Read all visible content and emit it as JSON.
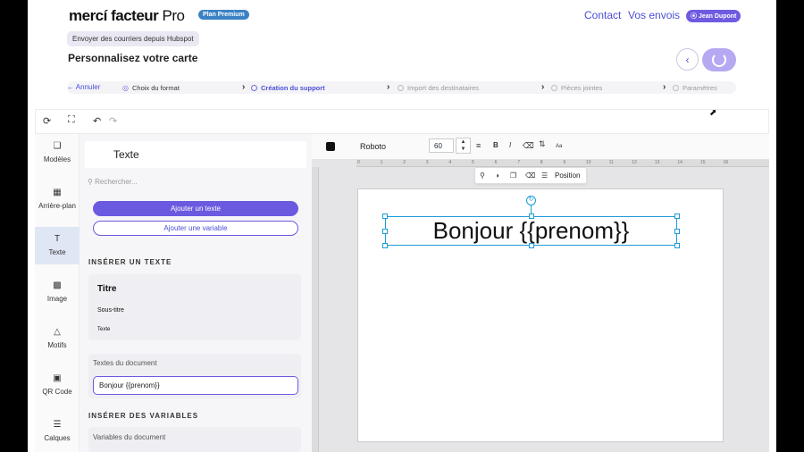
{
  "header": {
    "logo_main": "mercí facteur",
    "logo_pro": " Pro",
    "plan_badge": "Plan Premium",
    "nav_contact": "Contact",
    "nav_sends": "Vos envois",
    "user_badge": "⦿ Jean Dupont",
    "hubspot_chip": "Envoyer des courriers depuis Hubspot",
    "page_title": "Personnalisez votre carte"
  },
  "steps": {
    "cancel": "← Annuler",
    "items": [
      {
        "label": "Choix du format",
        "state": "done"
      },
      {
        "label": "Création du support",
        "state": "current"
      },
      {
        "label": "Import des destinataires",
        "state": "todo"
      },
      {
        "label": "Pièces jointes",
        "state": "todo"
      },
      {
        "label": "Paramètres",
        "state": "todo"
      }
    ]
  },
  "rail": {
    "items": [
      {
        "label": "Modèles",
        "icon": "templates-icon"
      },
      {
        "label": "Arrière-plan",
        "icon": "background-icon"
      },
      {
        "label": "Texte",
        "icon": "text-icon",
        "active": true
      },
      {
        "label": "Image",
        "icon": "image-icon"
      },
      {
        "label": "Motifs",
        "icon": "shapes-icon"
      },
      {
        "label": "QR Code",
        "icon": "qr-code-icon"
      },
      {
        "label": "Calques",
        "icon": "layers-icon"
      }
    ]
  },
  "panel": {
    "title": "Texte",
    "search_placeholder": "Rechercher...",
    "add_text": "Ajouter un texte",
    "add_variable": "Ajouter une variable",
    "insert_text_heading": "INSÉRER UN TEXTE",
    "insert_title": "Titre",
    "insert_subtitle": "Sous-titre",
    "insert_body": "Texte",
    "document_texts_label": "Textes du document",
    "document_text_item": "Bonjour {{prenom}}",
    "insert_variables_heading": "INSÉRER DES VARIABLES",
    "document_variables_label": "Variables du document"
  },
  "format_bar": {
    "text_color": "#111111",
    "font_name": "Roboto",
    "font_size": "60",
    "bold": "B",
    "italic": "I",
    "case": "Aa"
  },
  "ruler": {
    "numbers": [
      "0",
      "1",
      "2",
      "3",
      "4",
      "5",
      "6",
      "7",
      "8",
      "9",
      "10",
      "11",
      "12",
      "13",
      "14",
      "15",
      "16"
    ]
  },
  "canvas": {
    "floating_label": "Position",
    "card_text": "Bonjour {{prenom}}"
  },
  "colors": {
    "accent": "#6a5ae0",
    "link": "#4c4fd6",
    "selection": "#1e9bd8"
  }
}
